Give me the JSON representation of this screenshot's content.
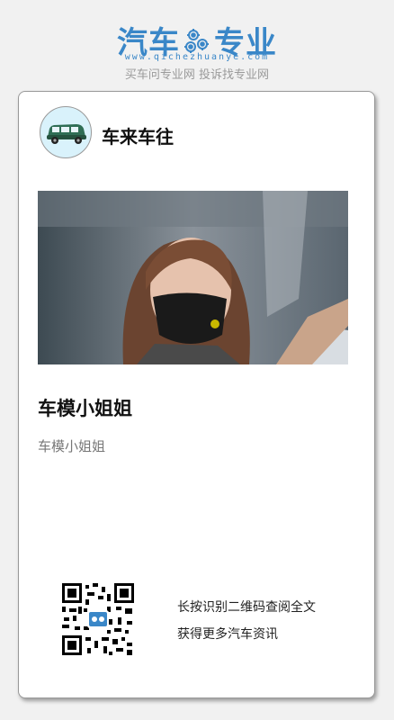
{
  "brand": {
    "logo_left": "汽车",
    "logo_right": "专业",
    "url": "www.qichezhuanye.com",
    "slogan": "买车问专业网 投诉找专业网",
    "color": "#3a87c8",
    "icon": "gear-icon"
  },
  "card": {
    "channel_name": "车来车往",
    "avatar_icon": "car-icon",
    "photo_icon": "article-photo",
    "title": "车模小姐姐",
    "description": "车模小姐姐",
    "qr_icon": "qr-code-icon",
    "qr_line1": "长按识别二维码查阅全文",
    "qr_line2": "获得更多汽车资讯"
  }
}
